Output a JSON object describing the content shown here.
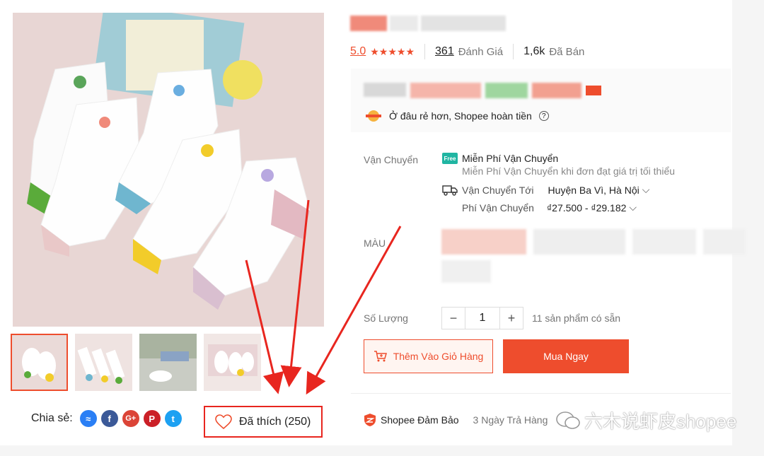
{
  "ratings": {
    "score": "5.0",
    "stars": "★★★★★",
    "review_count": "361",
    "review_label": "Đánh Giá",
    "sold_count": "1,6k",
    "sold_label": "Đã Bán"
  },
  "price": {
    "cashback_text": "Ở đâu rẻ hơn, Shopee hoàn tiền"
  },
  "shipping": {
    "label": "Vận Chuyển",
    "free_title": "Miễn Phí Vận Chuyển",
    "free_sub": "Miễn Phí Vận Chuyển khi đơn đạt giá trị tối thiểu",
    "to_label": "Vận Chuyển Tới",
    "to_value": "Huyện Ba Vì, Hà Nội",
    "fee_label": "Phí Vận Chuyển",
    "fee_value": "₫27.500 - ₫29.182"
  },
  "variation": {
    "color_label": "MÀU"
  },
  "quantity": {
    "label": "Số Lượng",
    "value": "1",
    "minus": "−",
    "plus": "+",
    "stock": "11 sản phẩm có sẵn"
  },
  "actions": {
    "add_to_cart": "Thêm Vào Giỏ Hàng",
    "buy_now": "Mua Ngay"
  },
  "share": {
    "label": "Chia sẻ:",
    "icons": [
      "messenger-icon",
      "facebook-icon",
      "google-plus-icon",
      "pinterest-icon",
      "twitter-icon"
    ]
  },
  "favorite": {
    "label": "Đã thích (250)"
  },
  "guarantee": {
    "label": "Shopee Đảm Bảo",
    "return": "3 Ngày Trả Hàng"
  },
  "watermark": {
    "text": "六木说虾皮shopee"
  },
  "colors": {
    "accent": "#ee4d2d",
    "annotation": "#e8261f"
  }
}
